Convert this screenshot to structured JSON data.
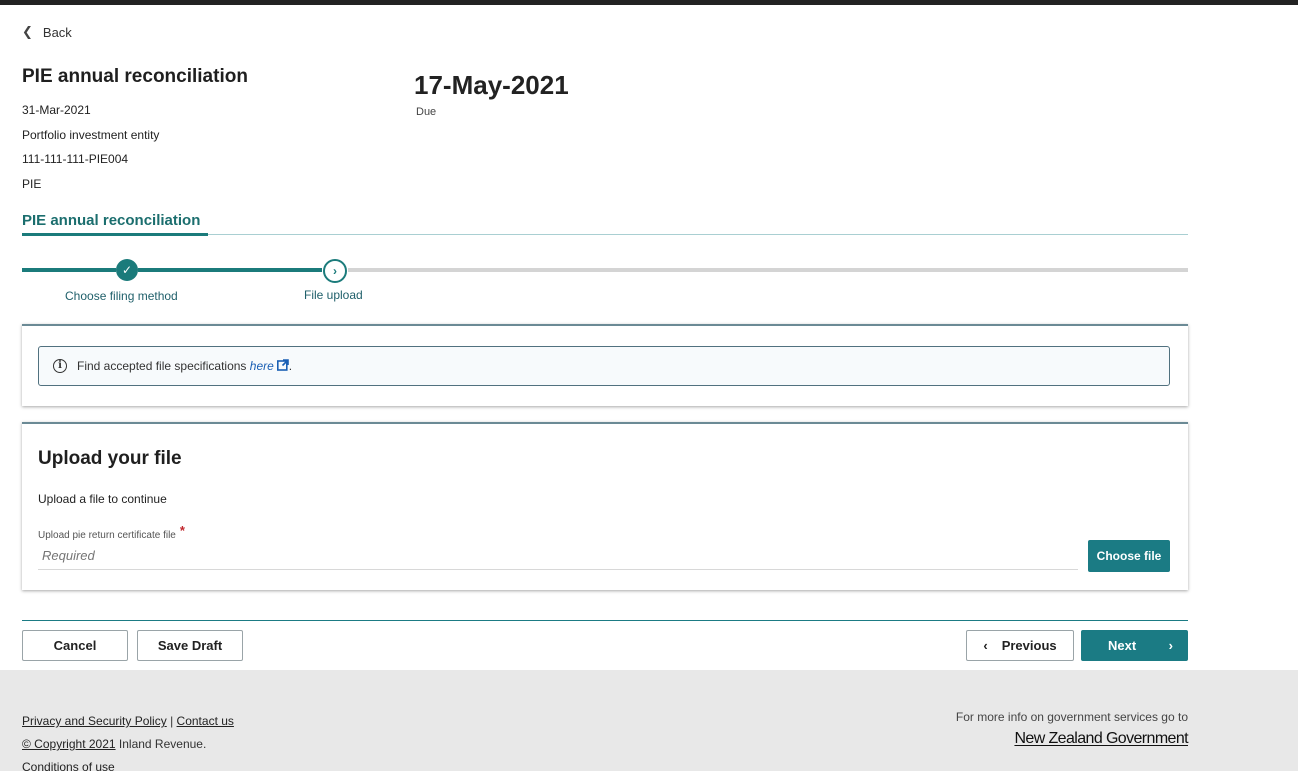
{
  "nav": {
    "back_label": "Back"
  },
  "entity": {
    "title": "PIE annual reconciliation",
    "period": "31-Mar-2021",
    "type": "Portfolio investment entity",
    "id": "111-111-111-PIE004",
    "short": "PIE"
  },
  "due": {
    "date": "17-May-2021",
    "label": "Due"
  },
  "section": {
    "tab_label": "PIE annual reconciliation"
  },
  "stepper": {
    "steps": [
      {
        "label": "Choose filing method",
        "status": "complete",
        "icon": "check-icon"
      },
      {
        "label": "File upload",
        "status": "current",
        "icon": "chevron-right-icon"
      }
    ]
  },
  "info": {
    "text": "Find accepted file specifications ",
    "link_text": "here",
    "suffix": ".",
    "icon": "info-icon"
  },
  "upload": {
    "title": "Upload your file",
    "subtitle": "Upload a file to continue",
    "field_label": "Upload pie return certificate file",
    "required_marker": "*",
    "placeholder": "Required",
    "choose_button": "Choose file"
  },
  "actions": {
    "cancel": "Cancel",
    "save_draft": "Save Draft",
    "previous": "Previous",
    "next": "Next"
  },
  "footer": {
    "privacy": "Privacy and Security Policy",
    "separator": "|",
    "contact": "Contact us",
    "copyright": "© Copyright 2021",
    "copyright_suffix": " Inland Revenue.",
    "conditions": "Conditions of use",
    "govt_info": "For more info on government services go to",
    "govt_logo": "New Zealand Government"
  },
  "colors": {
    "accent": "#1b7b84",
    "link": "#1a5fb4",
    "required": "#c1272d",
    "footer_bg": "#e8e8e8"
  }
}
